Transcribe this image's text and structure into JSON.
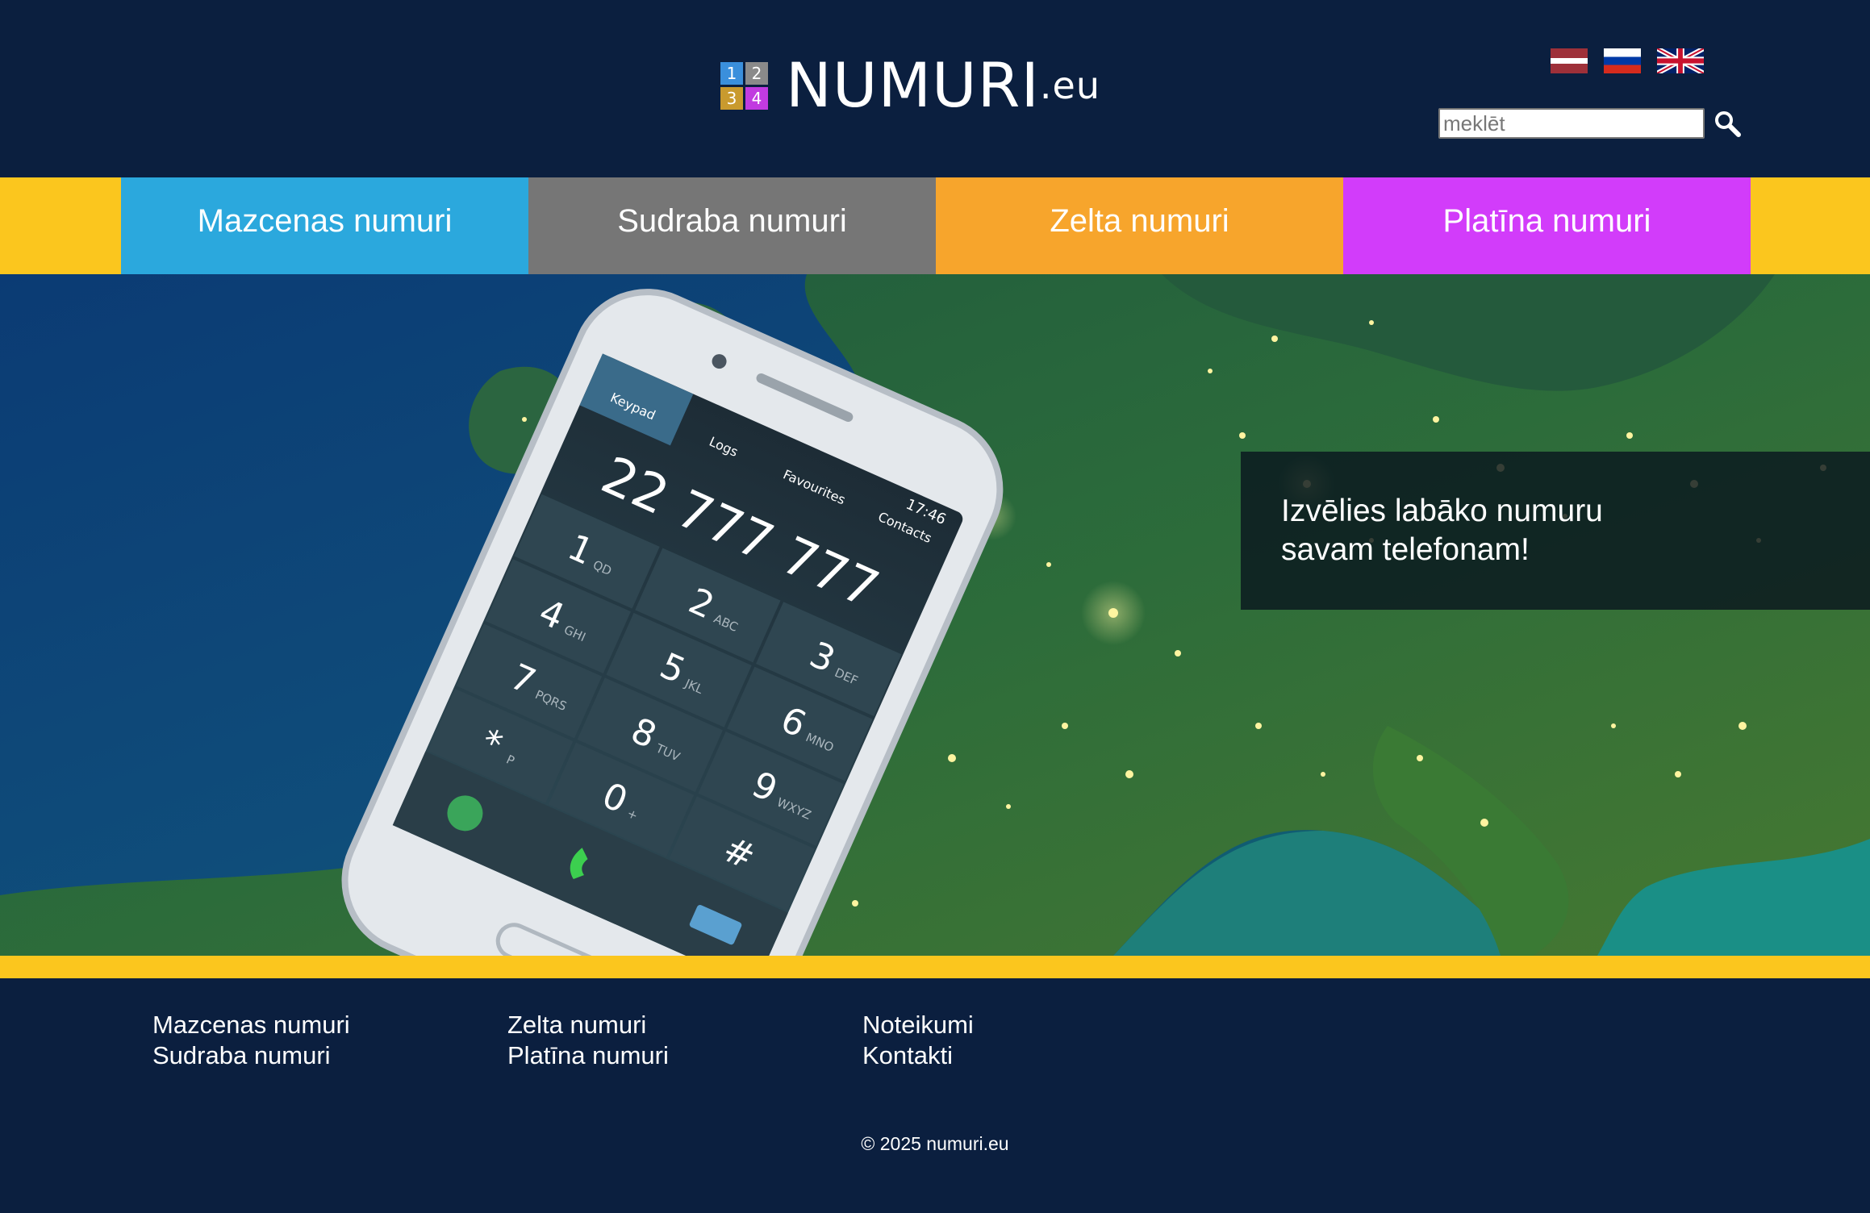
{
  "header": {
    "logo": {
      "digits": [
        "1",
        "2",
        "3",
        "4"
      ],
      "digit_colors": [
        "#3a8fdc",
        "#8a8a8a",
        "#c99a2e",
        "#c13be0"
      ],
      "name": "NUMURI",
      "suffix": ".eu"
    },
    "languages": [
      {
        "name": "Latvian",
        "icon": "latvia-flag-icon"
      },
      {
        "name": "Russian",
        "icon": "russia-flag-icon"
      },
      {
        "name": "English",
        "icon": "uk-flag-icon"
      }
    ],
    "search": {
      "placeholder": "meklēt",
      "value": "",
      "icon": "search-icon"
    }
  },
  "nav": {
    "items": [
      {
        "label": "Mazcenas numuri",
        "color": "#2ba8dd"
      },
      {
        "label": "Sudraba numuri",
        "color": "#767676"
      },
      {
        "label": "Zelta numuri",
        "color": "#f7a52c"
      },
      {
        "label": "Platīna numuri",
        "color": "#d23cfa"
      }
    ],
    "background_color": "#fbc61e"
  },
  "hero": {
    "caption_line1": "Izvēlies labāko numuru",
    "caption_line2": "savam telefonam!",
    "phone": {
      "number": "22 777 777",
      "time": "17:46",
      "tabs": [
        "Keypad",
        "Logs",
        "Favourites",
        "Contacts"
      ],
      "keys": [
        {
          "digit": "1",
          "letters": "QD"
        },
        {
          "digit": "2",
          "letters": "ABC"
        },
        {
          "digit": "3",
          "letters": "DEF"
        },
        {
          "digit": "4",
          "letters": "GHI"
        },
        {
          "digit": "5",
          "letters": "JKL"
        },
        {
          "digit": "6",
          "letters": "MNO"
        },
        {
          "digit": "7",
          "letters": "PQRS"
        },
        {
          "digit": "8",
          "letters": "TUV"
        },
        {
          "digit": "9",
          "letters": "WXYZ"
        },
        {
          "digit": "*",
          "letters": "P"
        },
        {
          "digit": "0",
          "letters": "+"
        },
        {
          "digit": "#",
          "letters": ""
        }
      ]
    }
  },
  "footer": {
    "columns": [
      [
        "Mazcenas numuri",
        "Sudraba numuri"
      ],
      [
        "Zelta numuri",
        "Platīna numuri"
      ],
      [
        "Noteikumi",
        "Kontakti"
      ]
    ],
    "copyright": "© 2025 numuri.eu"
  }
}
